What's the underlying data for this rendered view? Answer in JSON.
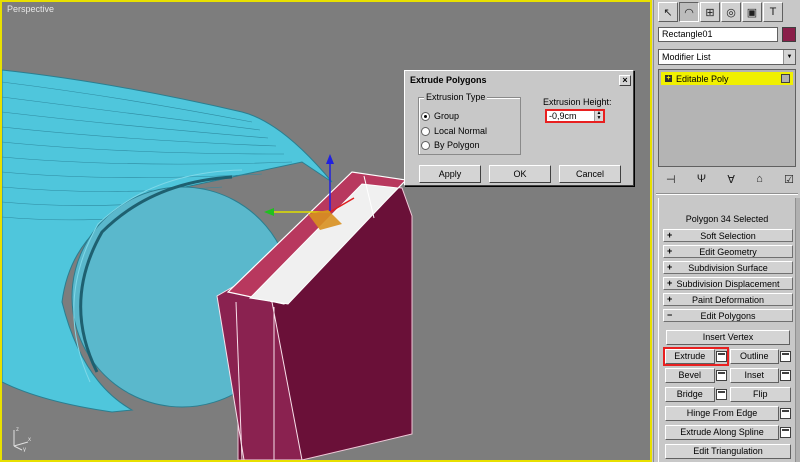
{
  "viewport": {
    "label": "Perspective",
    "ucs_x": "x",
    "ucs_y": "y",
    "ucs_z": "z"
  },
  "dialog": {
    "title": "Extrude Polygons",
    "close_label": "×",
    "extrusion_type_label": "Extrusion Type",
    "options": [
      "Group",
      "Local Normal",
      "By Polygon"
    ],
    "selected_option": "Group",
    "height_label": "Extrusion Height:",
    "height_value": "-0,9cm",
    "apply_label": "Apply",
    "ok_label": "OK",
    "cancel_label": "Cancel"
  },
  "panel": {
    "object_name": "Rectangle01",
    "object_color": "#8a1f4a",
    "modifier_list": "Modifier List",
    "stack_item": "Editable Poly",
    "selection_info": "Polygon 34 Selected",
    "rollouts": [
      {
        "sign": "+",
        "label": "Soft Selection"
      },
      {
        "sign": "+",
        "label": "Edit Geometry"
      },
      {
        "sign": "+",
        "label": "Subdivision Surface"
      },
      {
        "sign": "+",
        "label": "Subdivision Displacement"
      },
      {
        "sign": "+",
        "label": "Paint Deformation"
      },
      {
        "sign": "−",
        "label": "Edit Polygons"
      }
    ],
    "buttons": {
      "insert_vertex": "Insert Vertex",
      "extrude": "Extrude",
      "outline": "Outline",
      "bevel": "Bevel",
      "inset": "Inset",
      "bridge": "Bridge",
      "flip": "Flip",
      "hinge_from_edge": "Hinge From Edge",
      "extrude_along_spline": "Extrude Along Spline",
      "edit_triangulation": "Edit Triangulation"
    }
  },
  "colors": {
    "viewport_border": "#e8e000",
    "stack_highlight": "#f0f000",
    "highlight_outline": "#e82020",
    "object_cyan": "#4fc6dc",
    "object_maroon": "#6a1038"
  }
}
